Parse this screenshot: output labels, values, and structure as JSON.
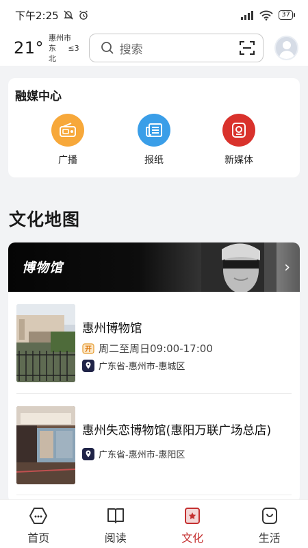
{
  "status_bar": {
    "time": "下午2:25",
    "battery": "37"
  },
  "header": {
    "temperature": "21°",
    "city": "惠州市",
    "wind_dir": "东北",
    "wind_level": "≤3",
    "search_placeholder": "搜索"
  },
  "media_center": {
    "title": "融媒中心",
    "items": [
      {
        "label": "广播",
        "icon": "radio-icon",
        "color": "#f7a83a"
      },
      {
        "label": "报纸",
        "icon": "newspaper-icon",
        "color": "#3a9ee8"
      },
      {
        "label": "新媒体",
        "icon": "new-media-icon",
        "color": "#d9322c"
      }
    ]
  },
  "culture_map": {
    "title": "文化地图",
    "banner_title": "博物馆",
    "museums": [
      {
        "name": "惠州博物馆",
        "hours": "周二至周日09:00-17:00",
        "address": "广东省-惠州市-惠城区"
      },
      {
        "name": "惠州失恋博物馆(惠阳万联广场总店)",
        "address": "广东省-惠州市-惠阳区"
      }
    ]
  },
  "tab_bar": {
    "tabs": [
      {
        "label": "首页",
        "icon": "home-icon"
      },
      {
        "label": "阅读",
        "icon": "book-icon"
      },
      {
        "label": "文化",
        "icon": "culture-icon",
        "active": true
      },
      {
        "label": "生活",
        "icon": "life-icon"
      }
    ]
  },
  "colors": {
    "accent": "#c42f2f"
  }
}
